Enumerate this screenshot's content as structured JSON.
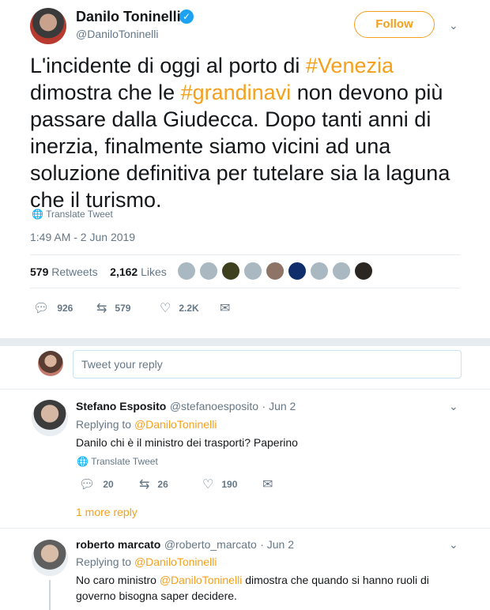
{
  "author": {
    "name": "Danilo Toninelli",
    "handle": "@DaniloToninelli",
    "verified_glyph": "✓"
  },
  "follow_label": "Follow",
  "tweet": {
    "text_parts": [
      {
        "t": "L'incidente di oggi al porto di ",
        "link": false
      },
      {
        "t": "#Venezia",
        "link": true
      },
      {
        "t": " dimostra che le ",
        "link": false
      },
      {
        "t": "#grandinavi",
        "link": true
      },
      {
        "t": " non devono più passare dalla Giudecca. Dopo tanti anni di inerzia, finalmente siamo vicini ad una soluzione definitiva per tutelare sia la laguna che il turismo.",
        "link": false
      }
    ],
    "translate": "Translate Tweet",
    "time": "1:49 AM - 2 Jun 2019",
    "retweets_count": "579",
    "retweets_label": "Retweets",
    "likes_count": "2,162",
    "likes_label": "Likes",
    "actions": {
      "replies": "926",
      "retweets": "579",
      "likes": "2.2K"
    }
  },
  "reply_placeholder": "Tweet your reply",
  "replies": [
    {
      "name": "Stefano Esposito",
      "handle": "@stefanoesposito",
      "date": "· Jun 2",
      "replying_label": "Replying to",
      "replying_to": "@DaniloToninelli",
      "text": "Danilo chi è il ministro dei trasporti? Paperino",
      "translate": "Translate Tweet",
      "actions": {
        "replies": "20",
        "retweets": "26",
        "likes": "190"
      },
      "more": "1 more reply"
    },
    {
      "name": "roberto marcato",
      "handle": "@roberto_marcato",
      "date": "· Jun 2",
      "replying_label": "Replying to",
      "replying_to": "@DaniloToninelli",
      "text_before": "No caro ministro ",
      "text_mention": "@DaniloToninelli",
      "text_after": " dimostra che quando si hanno ruoli di governo bisogna saper decidere."
    }
  ],
  "colors": {
    "accent": "#f5a01b",
    "verified": "#1da1f2",
    "muted": "#657786"
  },
  "icons": [
    "chevron-down-icon",
    "globe-icon",
    "reply-icon",
    "retweet-icon",
    "heart-icon",
    "message-icon"
  ]
}
